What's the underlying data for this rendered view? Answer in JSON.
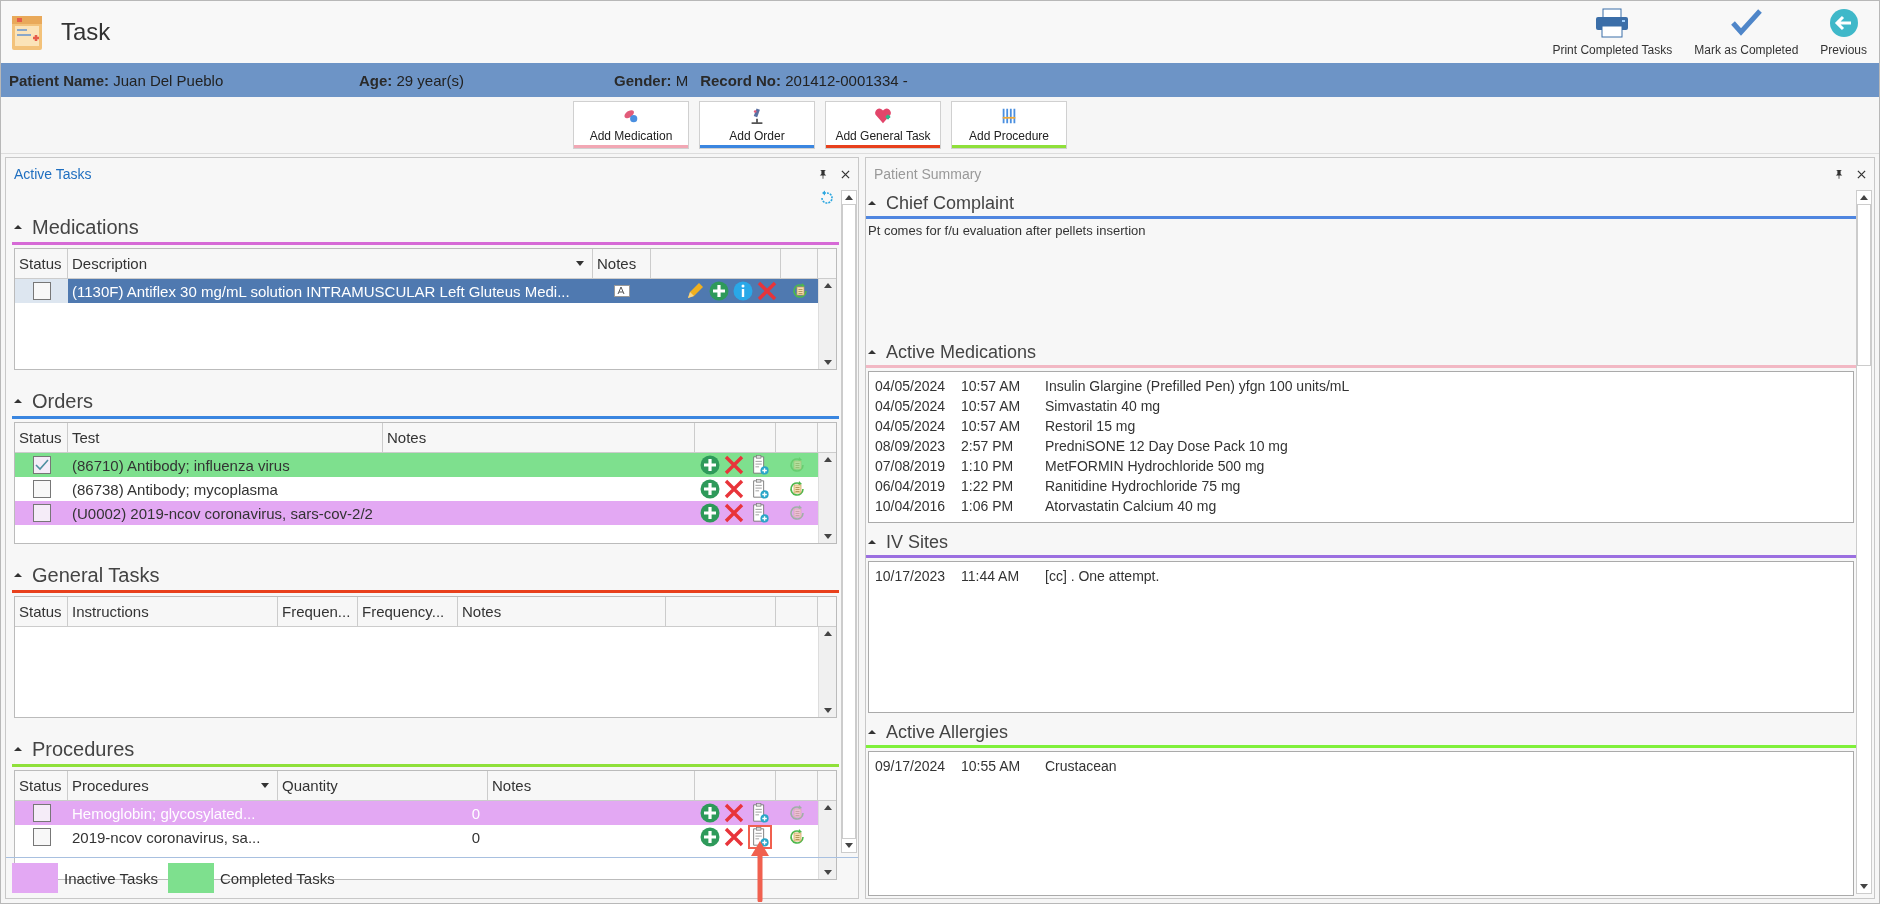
{
  "header": {
    "title": "Task",
    "actions": [
      {
        "kind": "print",
        "label": "Print Completed Tasks"
      },
      {
        "kind": "complete",
        "label": "Mark as Completed"
      },
      {
        "kind": "back",
        "label": "Previous"
      }
    ]
  },
  "patient": [
    {
      "label": "Patient Name:",
      "value": "Juan Del Pueblo"
    },
    {
      "label": "Age:",
      "value": "29 year(s)"
    },
    {
      "label": "Gender:",
      "value": "M"
    },
    {
      "label": "Record No:",
      "value": "201412-0001334 -"
    }
  ],
  "add_buttons": [
    {
      "kind": "medication",
      "label": "Add Medication",
      "color": "#f2a7b4"
    },
    {
      "kind": "order",
      "label": "Add Order",
      "color": "#3a86e0"
    },
    {
      "kind": "general",
      "label": "Add General Task",
      "color": "#e8401c"
    },
    {
      "kind": "procedure",
      "label": "Add Procedure",
      "color": "#8fe03a"
    }
  ],
  "active_tasks": {
    "title": "Active Tasks",
    "sections": [
      {
        "kind": "medication",
        "title": "Medications",
        "color": "#d66ad6",
        "expanded": true,
        "columns": [
          {
            "label": "Status"
          },
          {
            "label": "Description",
            "sortable": true
          },
          {
            "label": "Notes"
          }
        ],
        "rows": [
          {
            "completed": false,
            "inactive": false,
            "selected": true,
            "checked": false,
            "cells": [
              "",
              "(1130F) Antiflex 30 mg/mL solution INTRAMUSCULAR Left Gluteus Medi..."
            ],
            "has_note": true
          }
        ]
      },
      {
        "kind": "order",
        "title": "Orders",
        "color": "#3a86e0",
        "expanded": true,
        "columns": [
          {
            "label": "Status"
          },
          {
            "label": "Test"
          },
          {
            "label": "Notes"
          }
        ],
        "rows": [
          {
            "completed": true,
            "inactive": false,
            "selected": false,
            "checked": true,
            "highlighted": false,
            "cells": [
              "",
              "(86710) Antibody; influenza virus"
            ]
          },
          {
            "completed": false,
            "inactive": false,
            "selected": false,
            "checked": false,
            "highlighted": false,
            "cells": [
              "",
              "(86738) Antibody; mycoplasma"
            ]
          },
          {
            "completed": false,
            "inactive": true,
            "selected": false,
            "checked": false,
            "highlighted": false,
            "cells": [
              "",
              "(U0002) 2019-ncov coronavirus, sars-cov-2/2"
            ]
          }
        ]
      },
      {
        "kind": "general",
        "title": "General Tasks",
        "color": "#e8401c",
        "expanded": true,
        "columns": [
          {
            "label": "Status"
          },
          {
            "label": "Instructions"
          },
          {
            "label": "Frequen..."
          },
          {
            "label": "Frequency..."
          },
          {
            "label": "Notes"
          }
        ]
      },
      {
        "kind": "procedure",
        "title": "Procedures",
        "color": "#8fe03a",
        "expanded": true,
        "columns": [
          {
            "label": "Status"
          },
          {
            "label": "Procedures",
            "sortable": true
          },
          {
            "label": "Quantity"
          },
          {
            "label": "Notes"
          }
        ],
        "rows": [
          {
            "completed": false,
            "inactive": true,
            "selected": false,
            "checked": false,
            "highlighted": false,
            "cells": [
              "",
              "Hemoglobin; glycosylated...",
              "0"
            ]
          },
          {
            "completed": false,
            "inactive": false,
            "selected": false,
            "checked": false,
            "highlighted": true,
            "cells": [
              "",
              "2019-ncov coronavirus, sa...",
              "0"
            ]
          }
        ]
      }
    ]
  },
  "legend": [
    {
      "label": "Inactive Tasks",
      "color": "#e3a8f3"
    },
    {
      "label": "Completed Tasks",
      "color": "#7ee08e"
    }
  ],
  "patient_summary": {
    "title": "Patient Summary",
    "sections": [
      {
        "kind": "text",
        "title": "Chief Complaint",
        "color": "#4f86e0",
        "text": "Pt comes for f/u evaluation after pellets insertion"
      },
      {
        "kind": "list",
        "title": "Active Medications",
        "color": "#f2b8c4",
        "entries": [
          {
            "date": "04/05/2024",
            "time": "10:57 AM",
            "text": "Insulin Glargine (Prefilled Pen) yfgn 100 units/mL"
          },
          {
            "date": "04/05/2024",
            "time": "10:57 AM",
            "text": "Simvastatin 40 mg"
          },
          {
            "date": "04/05/2024",
            "time": "10:57 AM",
            "text": "Restoril 15 mg"
          },
          {
            "date": "08/09/2023",
            "time": "2:57 PM",
            "text": "PredniSONE 12 Day Dose Pack 10 mg"
          },
          {
            "date": "07/08/2019",
            "time": "1:10 PM",
            "text": "MetFORMIN Hydrochloride 500 mg"
          },
          {
            "date": "06/04/2019",
            "time": "1:22 PM",
            "text": "Ranitidine Hydrochloride 75 mg"
          },
          {
            "date": "10/04/2016",
            "time": "1:06 PM",
            "text": "Atorvastatin Calcium 40 mg"
          }
        ]
      },
      {
        "kind": "list",
        "title": "IV Sites",
        "color": "#9b6fe0",
        "entries": [
          {
            "date": "10/17/2023",
            "time": "11:44 AM",
            "text": "[cc] . One attempt."
          }
        ]
      },
      {
        "kind": "list",
        "title": "Active Allergies",
        "color": "#7ff03a",
        "entries": [
          {
            "date": "09/17/2024",
            "time": "10:55 AM",
            "text": "Crustacean"
          }
        ]
      }
    ]
  }
}
